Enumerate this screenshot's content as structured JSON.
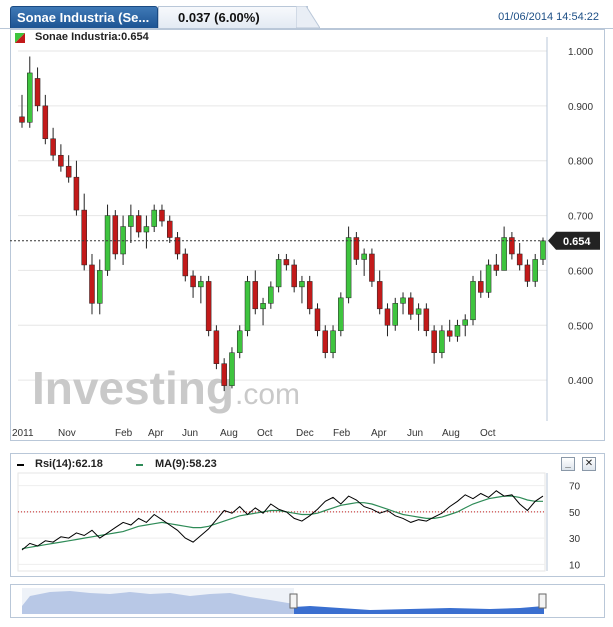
{
  "header": {
    "title": "Sonae Industria (Se...",
    "quote": "0.037 (6.00%)",
    "datetime": "01/06/2014 14:54:22"
  },
  "legend": {
    "label": "Sonae Industria:0.654"
  },
  "watermark": {
    "brand": "Investing",
    "suffix": ".com"
  },
  "rsi_legend": {
    "rsi_label": "Rsi(14):62.18",
    "ma_label": "MA(9):58.23"
  },
  "buttons": {
    "minimize": "_",
    "close": "✕"
  },
  "colors": {
    "up_candle": "#3ec43e",
    "down_candle": "#c21a1a",
    "rsi_line": "#000000",
    "ma_line": "#2e8b57",
    "accent": "#1d5493",
    "navigator_fill": "#3a6fd0"
  },
  "chart_data": [
    {
      "type": "candlestick",
      "title": "Sonae Industria",
      "last_price": 0.654,
      "last_price_label": "0.654",
      "x_tick_labels": [
        "2011",
        "Nov",
        "Feb",
        "Apr",
        "Jun",
        "Aug",
        "Oct",
        "Dec",
        "Feb",
        "Apr",
        "Jun",
        "Aug",
        "Oct"
      ],
      "y_tick_labels": [
        "1.000",
        "0.900",
        "0.800",
        "0.700",
        "0.600",
        "0.500",
        "0.400"
      ],
      "ylim": [
        0.3,
        1.0
      ],
      "grid": true,
      "candles": [
        {
          "o": 0.88,
          "h": 0.92,
          "l": 0.86,
          "c": 0.87
        },
        {
          "o": 0.87,
          "h": 0.99,
          "l": 0.86,
          "c": 0.96
        },
        {
          "o": 0.95,
          "h": 0.97,
          "l": 0.89,
          "c": 0.9
        },
        {
          "o": 0.9,
          "h": 0.92,
          "l": 0.83,
          "c": 0.84
        },
        {
          "o": 0.84,
          "h": 0.86,
          "l": 0.8,
          "c": 0.81
        },
        {
          "o": 0.81,
          "h": 0.83,
          "l": 0.78,
          "c": 0.79
        },
        {
          "o": 0.79,
          "h": 0.81,
          "l": 0.76,
          "c": 0.77
        },
        {
          "o": 0.77,
          "h": 0.8,
          "l": 0.7,
          "c": 0.71
        },
        {
          "o": 0.71,
          "h": 0.74,
          "l": 0.6,
          "c": 0.61
        },
        {
          "o": 0.61,
          "h": 0.63,
          "l": 0.52,
          "c": 0.54
        },
        {
          "o": 0.54,
          "h": 0.62,
          "l": 0.52,
          "c": 0.6
        },
        {
          "o": 0.6,
          "h": 0.72,
          "l": 0.59,
          "c": 0.7
        },
        {
          "o": 0.7,
          "h": 0.71,
          "l": 0.62,
          "c": 0.63
        },
        {
          "o": 0.63,
          "h": 0.7,
          "l": 0.61,
          "c": 0.68
        },
        {
          "o": 0.68,
          "h": 0.72,
          "l": 0.65,
          "c": 0.7
        },
        {
          "o": 0.7,
          "h": 0.71,
          "l": 0.66,
          "c": 0.67
        },
        {
          "o": 0.67,
          "h": 0.7,
          "l": 0.64,
          "c": 0.68
        },
        {
          "o": 0.68,
          "h": 0.72,
          "l": 0.67,
          "c": 0.71
        },
        {
          "o": 0.71,
          "h": 0.72,
          "l": 0.68,
          "c": 0.69
        },
        {
          "o": 0.69,
          "h": 0.7,
          "l": 0.65,
          "c": 0.66
        },
        {
          "o": 0.66,
          "h": 0.67,
          "l": 0.62,
          "c": 0.63
        },
        {
          "o": 0.63,
          "h": 0.64,
          "l": 0.58,
          "c": 0.59
        },
        {
          "o": 0.59,
          "h": 0.6,
          "l": 0.55,
          "c": 0.57
        },
        {
          "o": 0.57,
          "h": 0.59,
          "l": 0.54,
          "c": 0.58
        },
        {
          "o": 0.58,
          "h": 0.59,
          "l": 0.48,
          "c": 0.49
        },
        {
          "o": 0.49,
          "h": 0.5,
          "l": 0.42,
          "c": 0.43
        },
        {
          "o": 0.43,
          "h": 0.44,
          "l": 0.38,
          "c": 0.39
        },
        {
          "o": 0.39,
          "h": 0.46,
          "l": 0.385,
          "c": 0.45
        },
        {
          "o": 0.45,
          "h": 0.5,
          "l": 0.44,
          "c": 0.49
        },
        {
          "o": 0.49,
          "h": 0.59,
          "l": 0.48,
          "c": 0.58
        },
        {
          "o": 0.58,
          "h": 0.6,
          "l": 0.52,
          "c": 0.53
        },
        {
          "o": 0.53,
          "h": 0.55,
          "l": 0.5,
          "c": 0.54
        },
        {
          "o": 0.54,
          "h": 0.58,
          "l": 0.53,
          "c": 0.57
        },
        {
          "o": 0.57,
          "h": 0.63,
          "l": 0.56,
          "c": 0.62
        },
        {
          "o": 0.62,
          "h": 0.63,
          "l": 0.6,
          "c": 0.61
        },
        {
          "o": 0.61,
          "h": 0.62,
          "l": 0.56,
          "c": 0.57
        },
        {
          "o": 0.57,
          "h": 0.59,
          "l": 0.54,
          "c": 0.58
        },
        {
          "o": 0.58,
          "h": 0.59,
          "l": 0.52,
          "c": 0.53
        },
        {
          "o": 0.53,
          "h": 0.54,
          "l": 0.48,
          "c": 0.49
        },
        {
          "o": 0.49,
          "h": 0.5,
          "l": 0.44,
          "c": 0.45
        },
        {
          "o": 0.45,
          "h": 0.5,
          "l": 0.44,
          "c": 0.49
        },
        {
          "o": 0.49,
          "h": 0.56,
          "l": 0.48,
          "c": 0.55
        },
        {
          "o": 0.55,
          "h": 0.68,
          "l": 0.54,
          "c": 0.66
        },
        {
          "o": 0.66,
          "h": 0.67,
          "l": 0.61,
          "c": 0.62
        },
        {
          "o": 0.62,
          "h": 0.64,
          "l": 0.59,
          "c": 0.63
        },
        {
          "o": 0.63,
          "h": 0.64,
          "l": 0.57,
          "c": 0.58
        },
        {
          "o": 0.58,
          "h": 0.6,
          "l": 0.52,
          "c": 0.53
        },
        {
          "o": 0.53,
          "h": 0.54,
          "l": 0.48,
          "c": 0.5
        },
        {
          "o": 0.5,
          "h": 0.55,
          "l": 0.49,
          "c": 0.54
        },
        {
          "o": 0.54,
          "h": 0.56,
          "l": 0.52,
          "c": 0.55
        },
        {
          "o": 0.55,
          "h": 0.56,
          "l": 0.51,
          "c": 0.52
        },
        {
          "o": 0.52,
          "h": 0.54,
          "l": 0.49,
          "c": 0.53
        },
        {
          "o": 0.53,
          "h": 0.54,
          "l": 0.48,
          "c": 0.49
        },
        {
          "o": 0.49,
          "h": 0.5,
          "l": 0.43,
          "c": 0.45
        },
        {
          "o": 0.45,
          "h": 0.5,
          "l": 0.44,
          "c": 0.49
        },
        {
          "o": 0.49,
          "h": 0.51,
          "l": 0.47,
          "c": 0.48
        },
        {
          "o": 0.48,
          "h": 0.51,
          "l": 0.47,
          "c": 0.5
        },
        {
          "o": 0.5,
          "h": 0.52,
          "l": 0.48,
          "c": 0.51
        },
        {
          "o": 0.51,
          "h": 0.59,
          "l": 0.5,
          "c": 0.58
        },
        {
          "o": 0.58,
          "h": 0.6,
          "l": 0.55,
          "c": 0.56
        },
        {
          "o": 0.56,
          "h": 0.62,
          "l": 0.55,
          "c": 0.61
        },
        {
          "o": 0.61,
          "h": 0.63,
          "l": 0.59,
          "c": 0.6
        },
        {
          "o": 0.6,
          "h": 0.68,
          "l": 0.6,
          "c": 0.66
        },
        {
          "o": 0.66,
          "h": 0.67,
          "l": 0.62,
          "c": 0.63
        },
        {
          "o": 0.63,
          "h": 0.65,
          "l": 0.6,
          "c": 0.61
        },
        {
          "o": 0.61,
          "h": 0.62,
          "l": 0.57,
          "c": 0.58
        },
        {
          "o": 0.58,
          "h": 0.63,
          "l": 0.57,
          "c": 0.62
        },
        {
          "o": 0.62,
          "h": 0.66,
          "l": 0.61,
          "c": 0.654
        }
      ]
    },
    {
      "type": "line",
      "title": "Rsi(14) / MA(9)",
      "y_tick_labels": [
        "70",
        "50",
        "30",
        "10"
      ],
      "ylim": [
        5,
        75
      ],
      "reference_line": 50,
      "series": [
        {
          "name": "Rsi(14)",
          "values": [
            21,
            26,
            24,
            28,
            27,
            31,
            30,
            34,
            32,
            36,
            30,
            34,
            38,
            42,
            40,
            45,
            42,
            48,
            44,
            40,
            36,
            30,
            27,
            32,
            37,
            44,
            51,
            49,
            54,
            48,
            53,
            49,
            56,
            52,
            50,
            45,
            43,
            47,
            52,
            58,
            61,
            56,
            62,
            59,
            54,
            52,
            49,
            51,
            47,
            45,
            42,
            44,
            43,
            46,
            49,
            54,
            58,
            63,
            60,
            64,
            61,
            66,
            62,
            63,
            56,
            51,
            58,
            62
          ]
        },
        {
          "name": "MA(9)",
          "values": [
            22,
            23,
            24,
            25,
            26,
            27,
            28,
            29,
            30,
            31,
            32,
            33,
            34,
            35,
            37,
            39,
            40,
            41,
            42,
            41,
            40,
            39,
            38,
            38,
            39,
            41,
            43,
            45,
            47,
            48,
            49,
            50,
            51,
            51,
            50,
            49,
            48,
            48,
            49,
            51,
            53,
            55,
            56,
            57,
            57,
            56,
            54,
            52,
            50,
            48,
            47,
            46,
            45,
            45,
            46,
            48,
            50,
            53,
            56,
            58,
            60,
            61,
            62,
            62,
            61,
            59,
            58,
            58
          ]
        }
      ]
    }
  ]
}
